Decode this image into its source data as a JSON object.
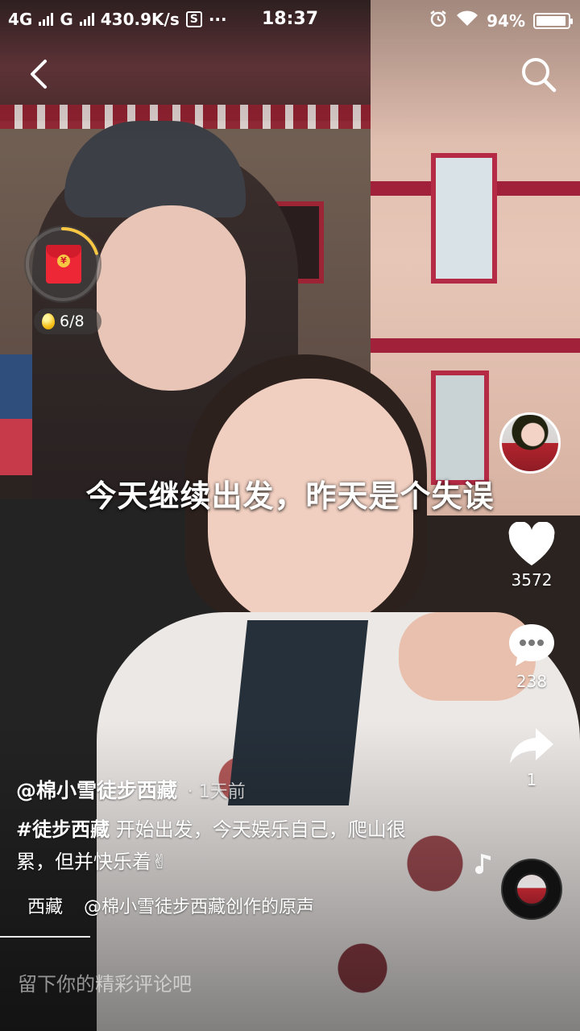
{
  "status_bar": {
    "network_1": "4G",
    "network_2": "G",
    "speed": "430.9K/s",
    "app_s": "S",
    "more": "···",
    "time": "18:37",
    "battery_pct": "94%",
    "battery_level": 0.94
  },
  "nav": {
    "back_icon": "chevron-left-icon",
    "search_icon": "search-icon"
  },
  "red_packet": {
    "progress": 0.2,
    "coin_symbol": "¥",
    "counter": "6/8"
  },
  "video": {
    "caption": "今天继续出发，昨天是个失误"
  },
  "rail": {
    "like_count": "3572",
    "comment_count": "238",
    "share_count": "1"
  },
  "info": {
    "author": "@棉小雪徒步西藏",
    "time": "· 1天前",
    "hashtag": "#徒步西藏",
    "description": " 开始出发，今天娱乐自己，爬山很累，但并快乐着✌",
    "location": "西藏",
    "music": "@棉小雪徒步西藏创作的原声"
  },
  "comment_box": {
    "placeholder": "留下你的精彩评论吧"
  },
  "colors": {
    "accent_red": "#ee2737",
    "ring_gold": "#f7c744"
  }
}
